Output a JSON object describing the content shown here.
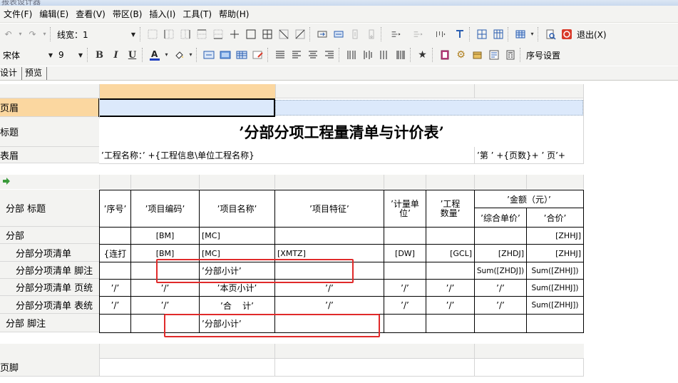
{
  "window": {
    "title": "报表设计器"
  },
  "menu": [
    "文件(F)",
    "编辑(E)",
    "查看(V)",
    "带区(B)",
    "插入(I)",
    "工具(T)",
    "帮助(H)"
  ],
  "toolbar1": {
    "line_width_label": "线宽：1",
    "exit_label": "退出(X)"
  },
  "toolbar2": {
    "font_name": "宋体",
    "font_size": "9",
    "bold": "B",
    "italic": "I",
    "underline": "U",
    "seq_setting_label": "序号设置",
    "accent_font_color": "#1f3fbf",
    "accent_fill_color": "#f0c040"
  },
  "tabs": [
    "设计",
    "预览"
  ],
  "bands": {
    "page_header": "页眉",
    "title": "标题",
    "table_header": "表眉",
    "sub_title": "分部 标题",
    "sub": "分部",
    "item_list": "分部分项清单",
    "item_footer": "分部分项清单 脚注",
    "item_page_total": "分部分项清单 页统",
    "item_table_total": "分部分项清单 表统",
    "sub_footer": "分部 脚注",
    "page_footer": "页脚"
  },
  "report": {
    "title": "’分部分项工程量清单与计价表’",
    "project_name_expr": "’工程名称：’ +{工程信息\\单位工程名称}",
    "page_expr": "’第 ’ +{页数}+ ’ 页’+",
    "columns": {
      "seq": "’序号’",
      "code": "’项目编码’",
      "name": "’项目名称’",
      "feature": "’项目特征’",
      "unit": "’计量单位’",
      "qty": "’工程数量’",
      "amount": "’金额（元）’",
      "unit_price": "’综合单价’",
      "total": "’合价’"
    },
    "row_sub": {
      "code": "[BM]",
      "name": "[MC]",
      "total": "[ZHHJ]"
    },
    "row_list": {
      "seq": "{连打",
      "code": "[BM]",
      "name": "[MC]",
      "feature": "[XMTZ]",
      "unit": "[DW]",
      "qty": "[GCL]",
      "unit_price": "[ZHDJ]",
      "total": "[ZHHJ]"
    },
    "row_item_footer": {
      "name": "’分部小计’",
      "unit_price": "Sum([ZHDJ])",
      "total": "Sum([ZHHJ])"
    },
    "row_page_total": {
      "seq": "’/’",
      "code": "’/’",
      "name": "’本页小计’",
      "feature": "’/’",
      "unit": "’/’",
      "qty": "’/’",
      "unit_price": "’/’",
      "total": "Sum([ZHHJ])"
    },
    "row_table_total": {
      "seq": "’/’",
      "code": "’/’",
      "name": "’合    计’",
      "feature": "’/’",
      "unit": "’/’",
      "qty": "’/’",
      "unit_price": "’/’",
      "total": "Sum([ZHHJ])"
    },
    "row_sub_footer": {
      "name": "’分部小计’"
    }
  },
  "colors": {
    "highlight_band": "#fbd7a0",
    "selected_cell": "#dce9fb",
    "annotation": "#e02a2a"
  }
}
